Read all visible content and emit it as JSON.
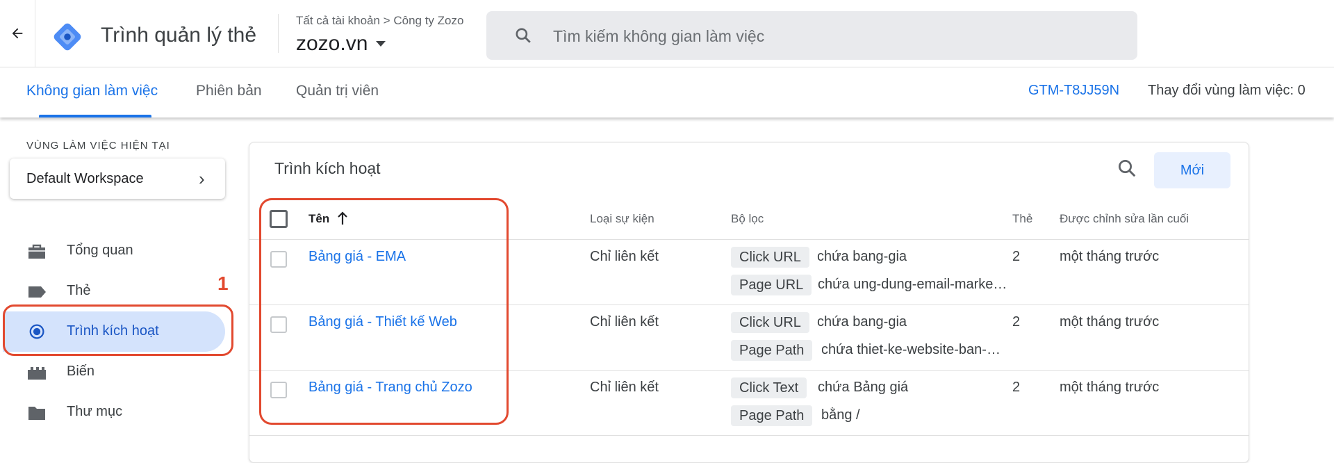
{
  "header": {
    "app_title": "Trình quản lý thẻ",
    "breadcrumb": "Tất cả tài khoản > Công ty Zozo",
    "container_name": "zozo.vn",
    "search_placeholder": "Tìm kiếm không gian làm việc"
  },
  "nav": {
    "tabs": [
      {
        "label": "Không gian làm việc",
        "active": true
      },
      {
        "label": "Phiên bản",
        "active": false
      },
      {
        "label": "Quản trị viên",
        "active": false
      }
    ],
    "container_id": "GTM-T8JJ59N",
    "workspace_changes": "Thay đổi vùng làm việc: 0"
  },
  "sidebar": {
    "workspace_label": "VÙNG LÀM VIỆC HIỆN TẠI",
    "workspace_name": "Default Workspace",
    "items": [
      {
        "label": "Tổng quan",
        "icon": "briefcase-icon",
        "active": false
      },
      {
        "label": "Thẻ",
        "icon": "tag-icon",
        "active": false
      },
      {
        "label": "Trình kích hoạt",
        "icon": "trigger-icon",
        "active": true
      },
      {
        "label": "Biến",
        "icon": "variable-icon",
        "active": false
      },
      {
        "label": "Thư mục",
        "icon": "folder-icon",
        "active": false
      }
    ]
  },
  "annotation": {
    "number": "1",
    "color": "#e2492f"
  },
  "main": {
    "title": "Trình kích hoạt",
    "new_label": "Mới",
    "columns": {
      "name": "Tên",
      "event_type": "Loại sự kiện",
      "filter": "Bộ lọc",
      "tags": "Thẻ",
      "last_edited": "Được chỉnh sửa lần cuối"
    },
    "rows": [
      {
        "name": "Bảng giá - EMA",
        "event_type": "Chỉ liên kết",
        "filters": [
          {
            "key": "Click URL",
            "value": "chứa bang-gia"
          },
          {
            "key": "Page URL",
            "value": "chứa ung-dung-email-marke…"
          }
        ],
        "tags": "2",
        "last_edited": "một tháng trước"
      },
      {
        "name": "Bảng giá - Thiết kế Web",
        "event_type": "Chỉ liên kết",
        "filters": [
          {
            "key": "Click URL",
            "value": "chứa bang-gia"
          },
          {
            "key": "Page Path",
            "value": "chứa thiet-ke-website-ban-…"
          }
        ],
        "tags": "2",
        "last_edited": "một tháng trước"
      },
      {
        "name": "Bảng giá - Trang chủ Zozo",
        "event_type": "Chỉ liên kết",
        "filters": [
          {
            "key": "Click Text",
            "value": "chứa Bảng giá"
          },
          {
            "key": "Page Path",
            "value": "bằng /"
          }
        ],
        "tags": "2",
        "last_edited": "một tháng trước"
      }
    ]
  },
  "colors": {
    "accent": "#1a73e8",
    "active_nav_bg": "#d4e3fc",
    "annotation": "#e2492f"
  }
}
